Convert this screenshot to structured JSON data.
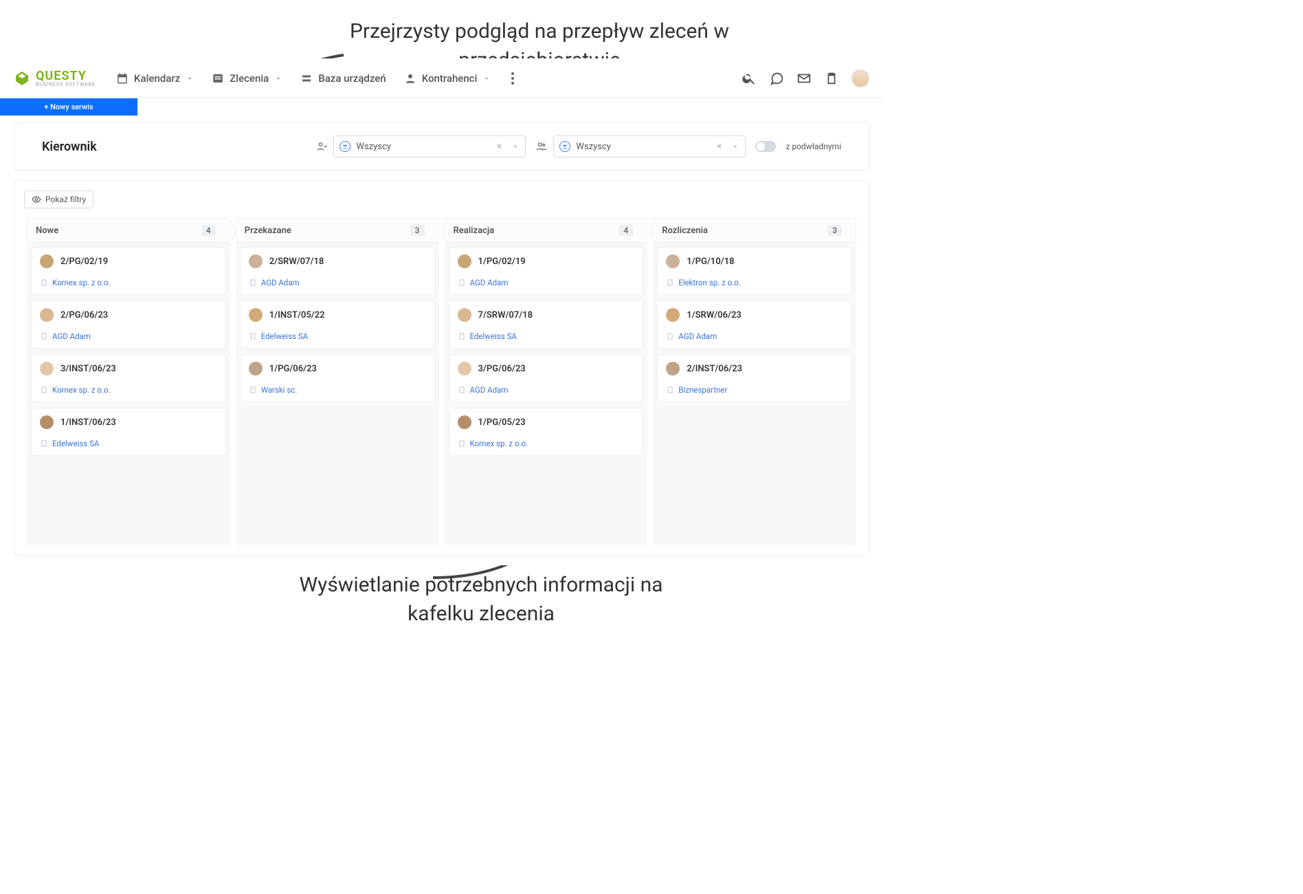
{
  "annotations": {
    "top": "Przejrzysty podgląd na przepływ\nzleceń w przedsiębiorstwie",
    "bottom": "Wyświetlanie potrzebnych\ninformacji na kafelku zlecenia"
  },
  "logo": {
    "brand": "QUESTY",
    "sub": "BUSINESS SOFTWARE"
  },
  "nav": {
    "calendar": "Kalendarz",
    "orders": "Zlecenia",
    "devices": "Baza urządzeń",
    "contractors": "Kontrahenci"
  },
  "new_service_btn": "Nowy serwis",
  "header": {
    "title": "Kierownik",
    "select1": "Wszyscy",
    "select2": "Wszyscy",
    "toggle_label": "z podwładnymi"
  },
  "filters_btn": "Pokaż filtry",
  "columns": [
    {
      "title": "Nowe",
      "count": "4",
      "cards": [
        {
          "id": "2/PG/02/19",
          "company": "Kornex sp. z o.o."
        },
        {
          "id": "2/PG/06/23",
          "company": "AGD Adam"
        },
        {
          "id": "3/INST/06/23",
          "company": "Kornex sp. z o.o."
        },
        {
          "id": "1/INST/06/23",
          "company": "Edelweiss SA"
        }
      ]
    },
    {
      "title": "Przekazane",
      "count": "3",
      "cards": [
        {
          "id": "2/SRW/07/18",
          "company": "AGD Adam"
        },
        {
          "id": "1/INST/05/22",
          "company": "Edelweiss SA"
        },
        {
          "id": "1/PG/06/23",
          "company": "Warski sc."
        }
      ]
    },
    {
      "title": "Realizacja",
      "count": "4",
      "cards": [
        {
          "id": "1/PG/02/19",
          "company": "AGD Adam"
        },
        {
          "id": "7/SRW/07/18",
          "company": "Edelweiss SA"
        },
        {
          "id": "3/PG/06/23",
          "company": "AGD Adam"
        },
        {
          "id": "1/PG/05/23",
          "company": "Kornex sp. z o.o."
        }
      ]
    },
    {
      "title": "Rozliczenia",
      "count": "3",
      "cards": [
        {
          "id": "1/PG/10/18",
          "company": "Elektron sp. z o.o."
        },
        {
          "id": "1/SRW/06/23",
          "company": "AGD Adam"
        },
        {
          "id": "2/INST/06/23",
          "company": "Biznespartner"
        }
      ]
    }
  ]
}
